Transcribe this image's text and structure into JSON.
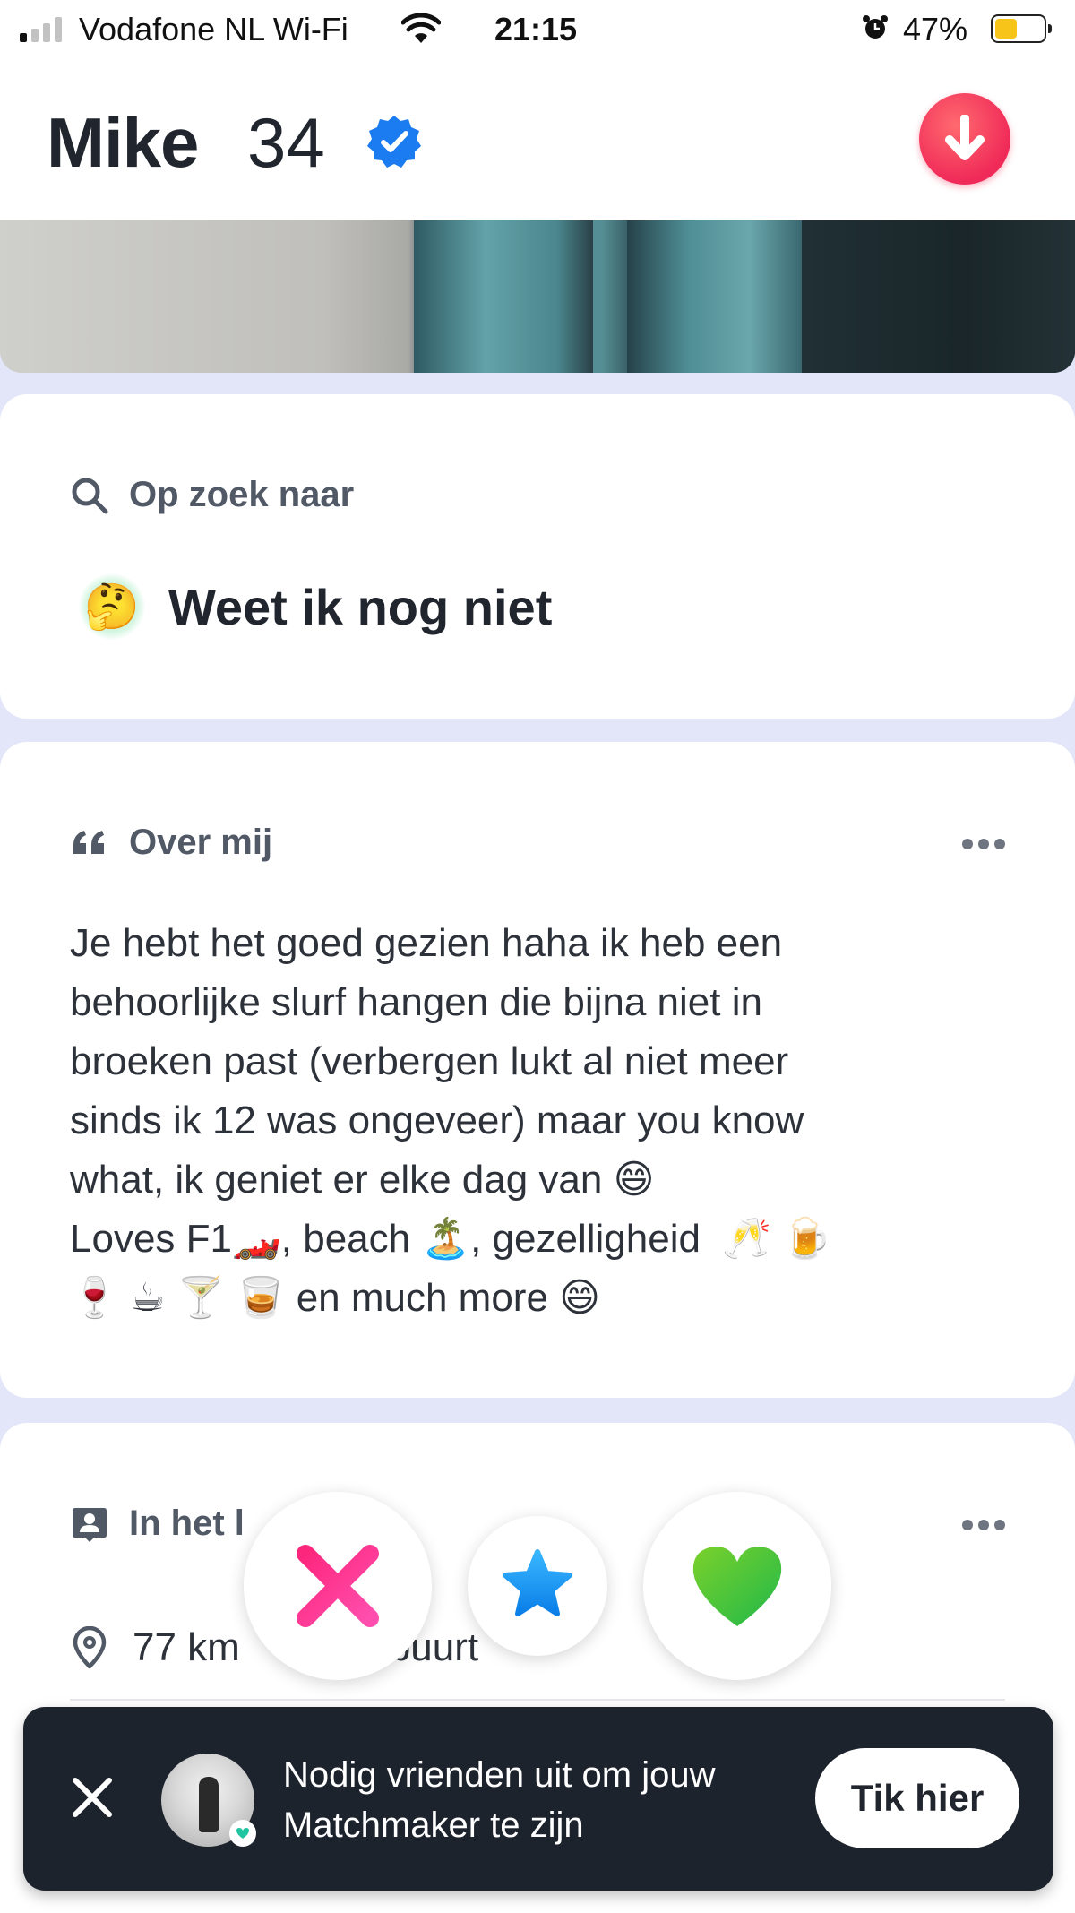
{
  "status_bar": {
    "carrier": "Vodafone NL Wi-Fi",
    "time": "21:15",
    "battery_percent_text": "47%",
    "battery_level": 0.47,
    "battery_color": "#f7c51a",
    "icons": [
      "signal-icon",
      "wifi-icon",
      "alarm-icon",
      "battery-icon"
    ]
  },
  "profile": {
    "name": "Mike",
    "age": "34",
    "verified": true,
    "verified_color": "#1a7cf0",
    "accent_color": "#f02a58"
  },
  "looking_for": {
    "title": "Op zoek naar",
    "emoji": "🤔",
    "value": "Weet ik nog niet"
  },
  "about": {
    "title": "Over mij",
    "text": "Je hebt het goed gezien haha ik heb een\nbehoorlijke slurf hangen die bijna niet in\nbroeken past (verbergen lukt al niet meer\nsinds ik 12 was ongeveer) maar you know\nwhat, ik geniet er elke dag van 😄\nLoves F1🏎️, beach 🏝️, gezelligheid  🥂 🍺\n🍷 ☕ 🍸 🥃 en much more 😄"
  },
  "basics": {
    "title": "In het l",
    "location": "77 km",
    "location_suffix": "buurt"
  },
  "actions": {
    "nope_color": "#f5237a",
    "superlike_color": "#1c8ff5",
    "like_color": "#3ac62e"
  },
  "banner": {
    "text": "Nodig vrienden uit om jouw Matchmaker te zijn",
    "cta": "Tik hier",
    "background": "#1d232d"
  }
}
